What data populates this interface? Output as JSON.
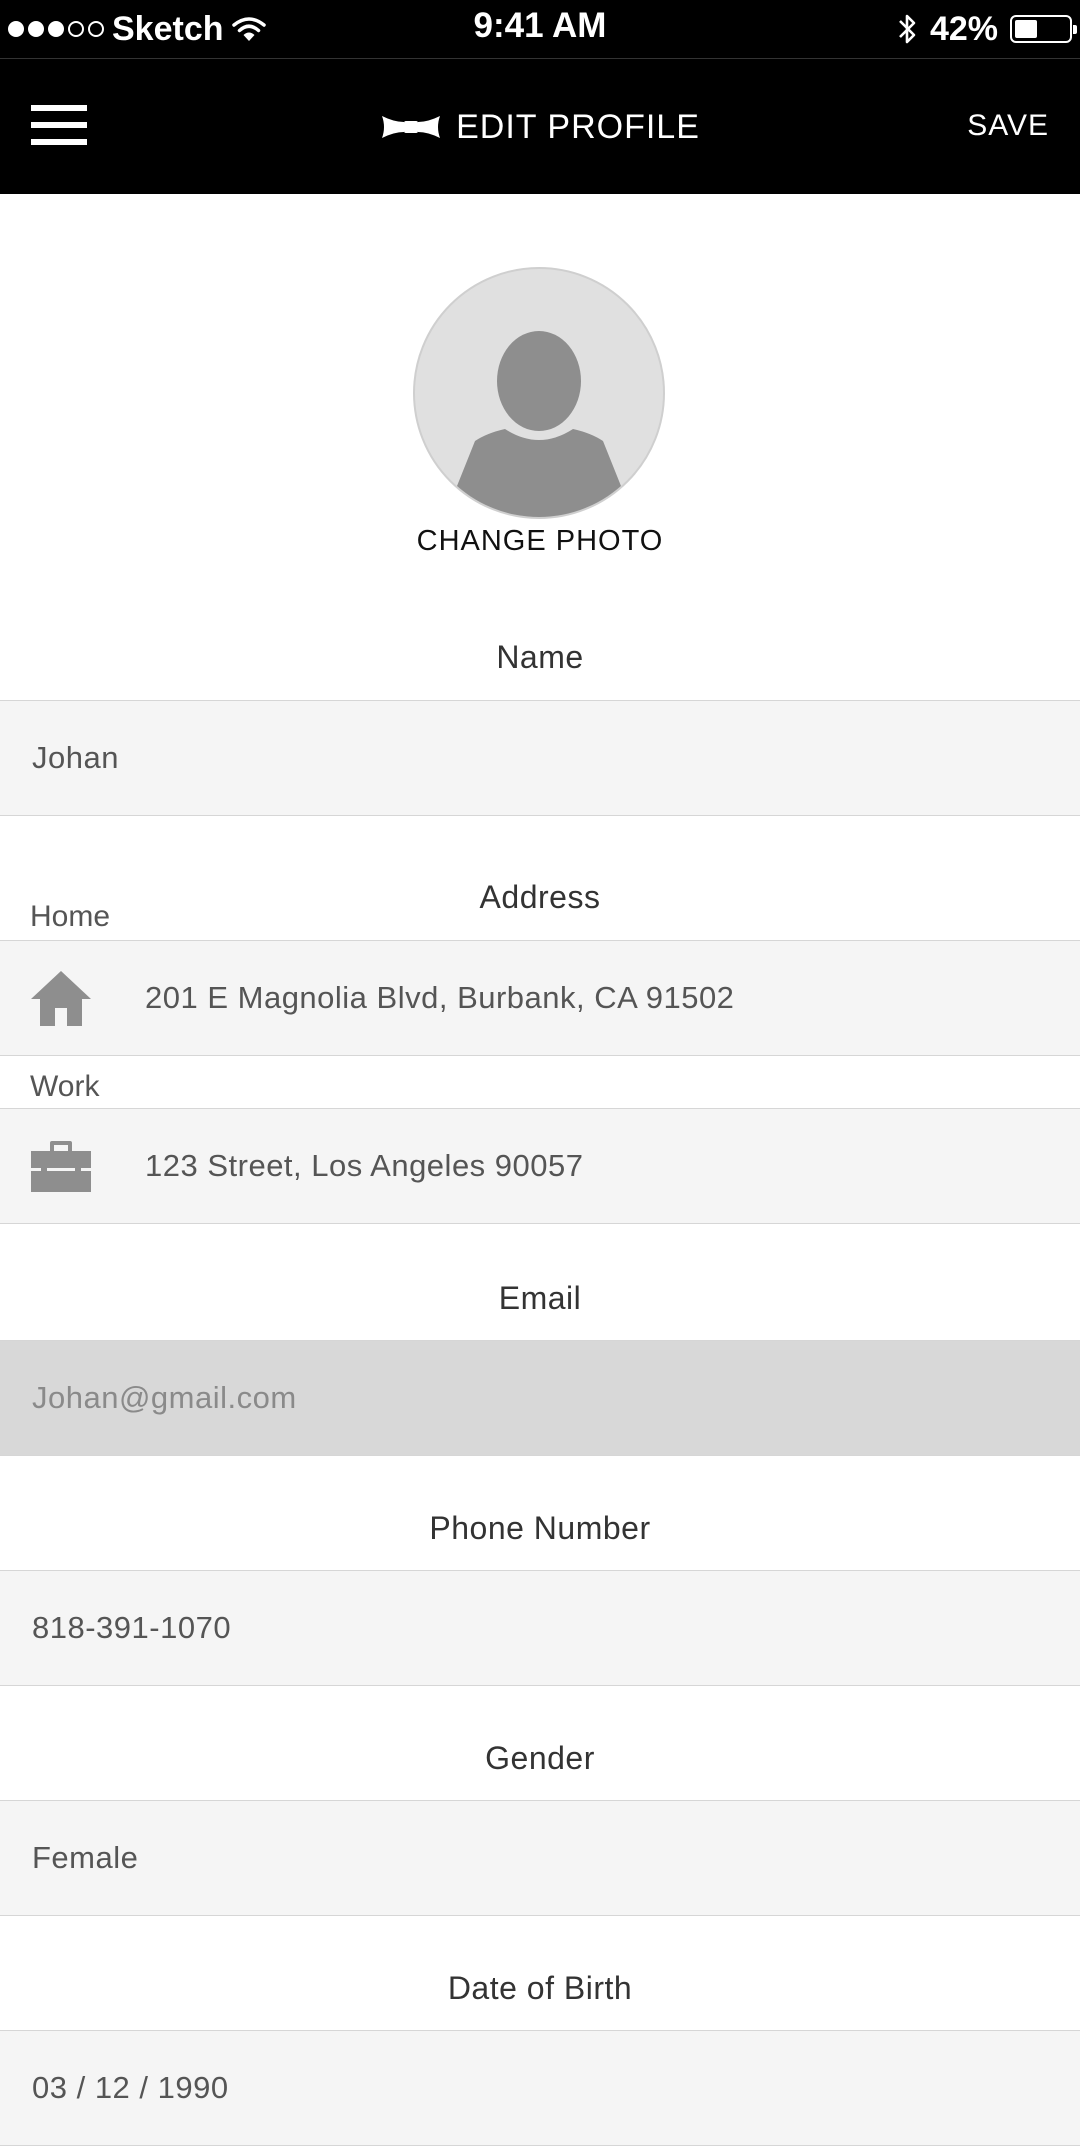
{
  "status_bar": {
    "carrier": "Sketch",
    "time": "9:41 AM",
    "battery_percent": "42%",
    "battery_level": 0.42,
    "signal_bars_filled": 3,
    "signal_bars_total": 5
  },
  "nav": {
    "title": "EDIT PROFILE",
    "save_label": "SAVE",
    "menu_icon": "hamburger-icon",
    "logo_icon": "bowtie-icon"
  },
  "photo": {
    "change_label": "CHANGE PHOTO",
    "placeholder_icon": "person-silhouette-icon"
  },
  "form": {
    "name": {
      "label": "Name",
      "value": "Johan"
    },
    "address": {
      "label": "Address",
      "home": {
        "label": "Home",
        "value": "201 E Magnolia Blvd, Burbank, CA 91502",
        "icon": "home-icon"
      },
      "work": {
        "label": "Work",
        "value": "123 Street, Los Angeles 90057",
        "icon": "briefcase-icon"
      }
    },
    "email": {
      "label": "Email",
      "value": "Johan@gmail.com"
    },
    "phone": {
      "label": "Phone Number",
      "value": "818-391-1070"
    },
    "gender": {
      "label": "Gender",
      "value": "Female"
    },
    "dob": {
      "label": "Date of Birth",
      "value": "03 / 12 / 1990"
    }
  },
  "colors": {
    "header_bg": "#000000",
    "field_bg": "#f5f5f5",
    "disabled_field_bg": "#d8d8d8",
    "icon_gray": "#8e8e8e"
  }
}
